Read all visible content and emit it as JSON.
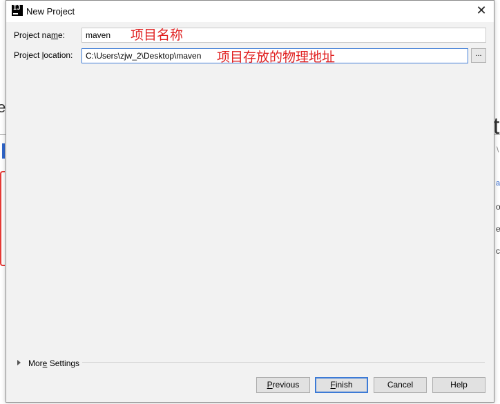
{
  "window": {
    "title": "New Project",
    "app_icon": "intellij-icon",
    "close_icon": "close-icon"
  },
  "form": {
    "name_label_pre": "Project na",
    "name_label_mnemonic": "m",
    "name_label_post": "e:",
    "name_value": "maven",
    "name_annotation": "项目名称",
    "location_label_pre": "Project ",
    "location_label_mnemonic": "l",
    "location_label_post": "ocation:",
    "location_value": "C:\\Users\\zjw_2\\Desktop\\maven",
    "location_annotation": "项目存放的物理地址",
    "browse_label": "..."
  },
  "more_settings": {
    "label_pre": "Mor",
    "label_mnemonic": "e",
    "label_post": " Settings",
    "expanded": false
  },
  "buttons": {
    "previous_mnemonic": "P",
    "previous_rest": "revious",
    "finish_mnemonic": "F",
    "finish_rest": "inish",
    "cancel": "Cancel",
    "help": "Help"
  },
  "background": {
    "left_fragment": "e",
    "right_fragment_big": "t",
    "right_fragment_1": "\\",
    "right_fragment_2": "at",
    "right_fragment_3": "o",
    "right_fragment_4": "er",
    "right_fragment_5": "cl"
  },
  "colors": {
    "annotation": "#e02020",
    "focus": "#3d7bd6",
    "dialog_bg": "#f2f2f2"
  }
}
